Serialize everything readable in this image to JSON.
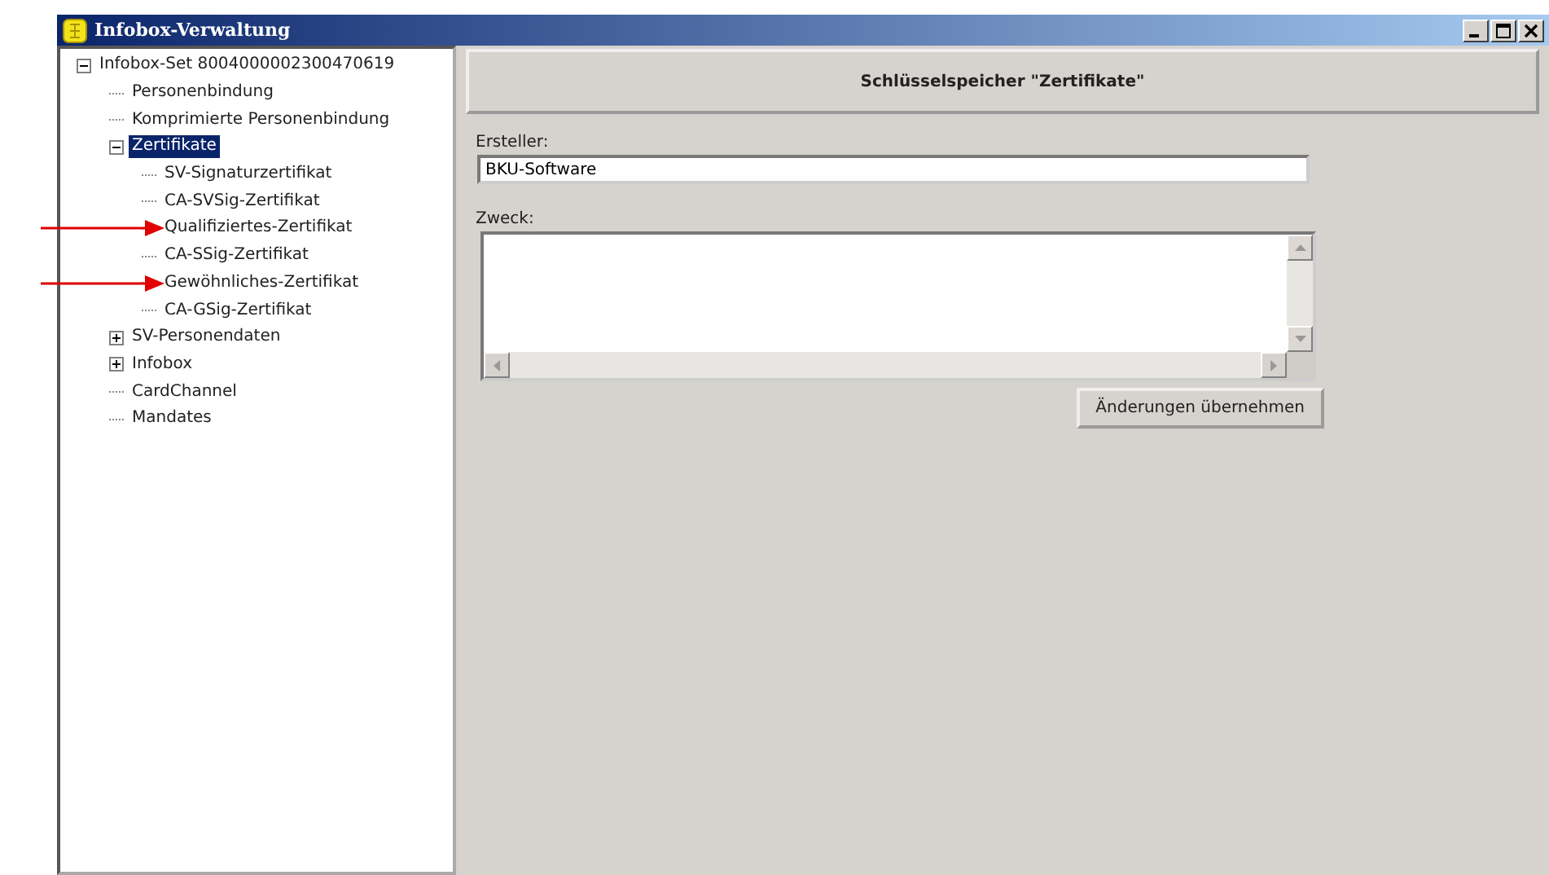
{
  "window": {
    "title": "Infobox-Verwaltung"
  },
  "tree": [
    {
      "label": "Infobox-Set 8004000002300470619",
      "expanded": true,
      "selected": false,
      "marked": false,
      "children": [
        {
          "label": "Personenbindung",
          "selected": false,
          "marked": false
        },
        {
          "label": "Komprimierte Personenbindung",
          "selected": false,
          "marked": false
        },
        {
          "label": "Zertifikate",
          "expanded": true,
          "selected": true,
          "marked": false,
          "children": [
            {
              "label": "SV-Signaturzertifikat",
              "selected": false,
              "marked": false
            },
            {
              "label": "CA-SVSig-Zertifikat",
              "selected": false,
              "marked": false
            },
            {
              "label": "Qualifiziertes-Zertifikat",
              "selected": false,
              "marked": true
            },
            {
              "label": "CA-SSig-Zertifikat",
              "selected": false,
              "marked": false
            },
            {
              "label": "Gewöhnliches-Zertifikat",
              "selected": false,
              "marked": true
            },
            {
              "label": "CA-GSig-Zertifikat",
              "selected": false,
              "marked": false
            }
          ]
        },
        {
          "label": "SV-Personendaten",
          "expanded": false,
          "selected": false,
          "marked": false
        },
        {
          "label": "Infobox",
          "expanded": false,
          "selected": false,
          "marked": false
        },
        {
          "label": "CardChannel",
          "selected": false,
          "marked": false
        },
        {
          "label": "Mandates",
          "selected": false,
          "marked": false
        }
      ]
    }
  ],
  "panel": {
    "heading": "Schlüsselspeicher \"Zertifikate\"",
    "fields": [
      {
        "label": "Ersteller:",
        "kind": "line",
        "value": "BKU-Software"
      },
      {
        "label": "Zweck:",
        "kind": "area"
      }
    ],
    "button": "Änderungen übernehmen"
  }
}
